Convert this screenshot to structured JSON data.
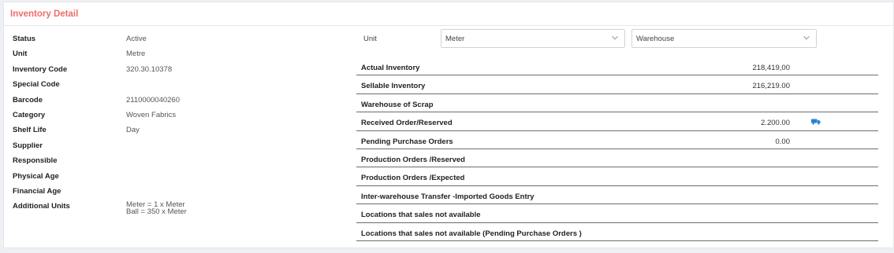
{
  "panel": {
    "title": "Inventory Detail"
  },
  "details": [
    {
      "label": "Status",
      "value": "Active"
    },
    {
      "label": "Unit",
      "value": "Metre"
    },
    {
      "label": "Inventory Code",
      "value": "320.30.10378"
    },
    {
      "label": "Special Code",
      "value": ""
    },
    {
      "label": "Barcode",
      "value": "2110000040260"
    },
    {
      "label": "Category",
      "value": "Woven Fabrics"
    },
    {
      "label": "Shelf Life",
      "value": "Day"
    },
    {
      "label": "Supplier",
      "value": ""
    },
    {
      "label": "Responsible",
      "value": ""
    },
    {
      "label": "Physical Age",
      "value": ""
    },
    {
      "label": "Financial Age",
      "value": ""
    },
    {
      "label": "Additional Units",
      "value_lines": [
        "Meter = 1 x Meter",
        "Ball = 350 x Meter"
      ]
    }
  ],
  "filters": {
    "unit_label": "Unit",
    "unit_select": "Meter",
    "warehouse_select": "Warehouse"
  },
  "inventory": [
    {
      "label": "Actual Inventory",
      "value": "218,419,00"
    },
    {
      "label": "Sellable Inventory",
      "value": "216,219.00"
    },
    {
      "label": "Warehouse of Scrap",
      "value": ""
    },
    {
      "label": "Received Order/Reserved",
      "value": "2.200.00",
      "icon": "truck-icon"
    },
    {
      "label": "Pending Purchase Orders",
      "value": "0.00"
    },
    {
      "label": "Production Orders /Reserved",
      "value": ""
    },
    {
      "label": "Production Orders /Expected",
      "value": ""
    },
    {
      "label": "Inter-warehouse Transfer -Imported Goods Entry",
      "value": ""
    },
    {
      "label": "Locations that sales not available",
      "value": ""
    },
    {
      "label": "Locations that sales not available (Pending Purchase Orders )",
      "value": ""
    }
  ],
  "colors": {
    "title": "#f06b6b",
    "truck": "#2a7fd4",
    "row_border": "#6b6b6b"
  }
}
